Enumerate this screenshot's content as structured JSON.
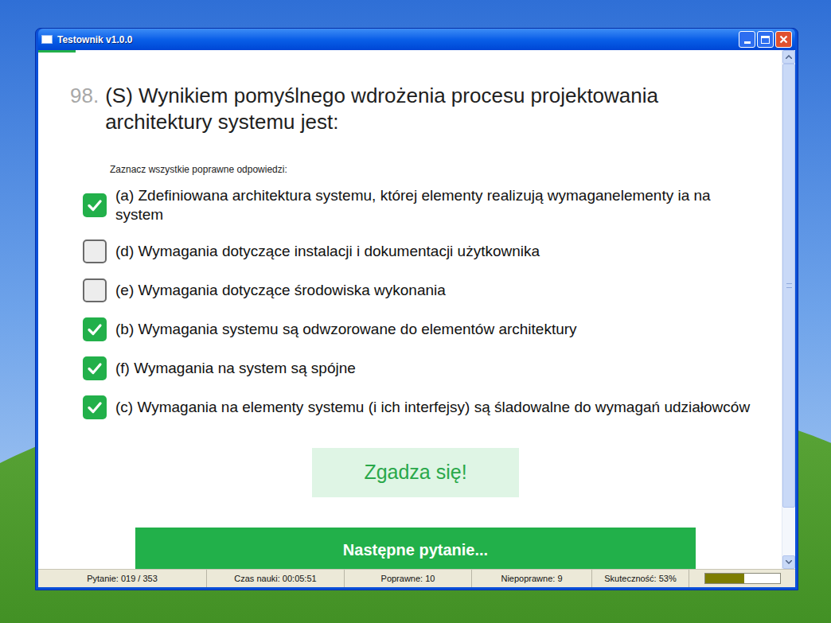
{
  "window": {
    "title": "Testownik v1.0.0"
  },
  "progress": {
    "level": 0.05
  },
  "question": {
    "number": "98.",
    "text": "(S) Wynikiem pomyślnego wdrożenia procesu projektowania architektury systemu jest:"
  },
  "instruction": "Zaznacz wszystkie poprawne odpowiedzi:",
  "answers": [
    {
      "text": "(a) Zdefiniowana architektura systemu, której elementy realizują wymaganelementy ia na system",
      "checked": true
    },
    {
      "text": "(d) Wymagania dotyczące instalacji i dokumentacji użytkownika",
      "checked": false
    },
    {
      "text": "(e) Wymagania dotyczące środowiska wykonania",
      "checked": false
    },
    {
      "text": "(b) Wymagania systemu są odwzorowane do elementów architektury",
      "checked": true
    },
    {
      "text": "(f) Wymagania na system są spójne",
      "checked": true
    },
    {
      "text": "(c) Wymagania na elementy systemu (i ich interfejsy) są śladowalne do wymagań udziałowców",
      "checked": true
    }
  ],
  "buttons": {
    "confirm": "Zgadza się!",
    "next": "Następne pytanie..."
  },
  "status_bar": {
    "question": "Pytanie: 019 / 353",
    "time": "Czas nauki: 00:05:51",
    "correct": "Poprawne: 10",
    "incorrect": "Niepoprawne: 9",
    "effectiveness": "Skuteczność: 53%",
    "level": 0.53
  }
}
